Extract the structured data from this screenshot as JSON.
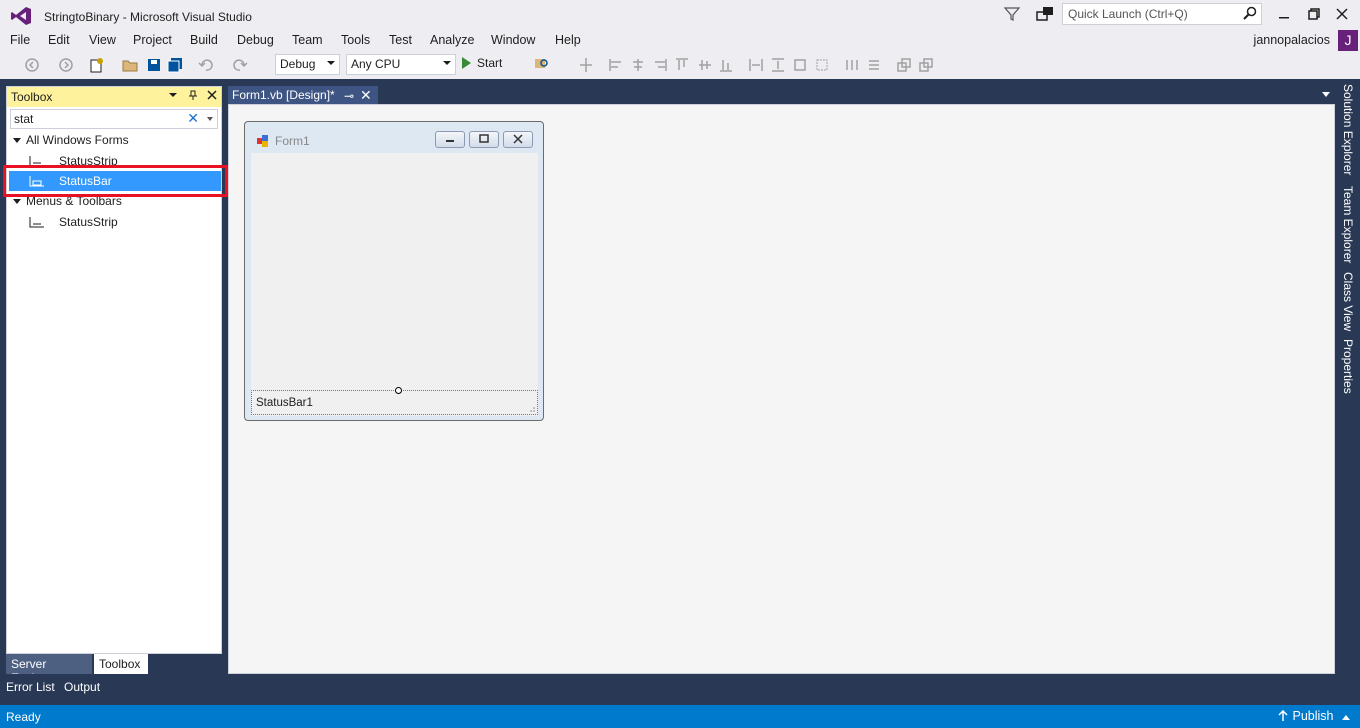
{
  "window": {
    "title": "StringtoBinary - Microsoft Visual Studio"
  },
  "quick_launch": {
    "placeholder": "Quick Launch (Ctrl+Q)"
  },
  "menu": [
    "File",
    "Edit",
    "View",
    "Project",
    "Build",
    "Debug",
    "Team",
    "Tools",
    "Test",
    "Analyze",
    "Window",
    "Help"
  ],
  "user": {
    "name": "jannopalacios",
    "initial": "J"
  },
  "toolbar": {
    "config": "Debug",
    "platform": "Any CPU",
    "start_label": "Start"
  },
  "toolbox": {
    "title": "Toolbox",
    "search_value": "stat",
    "categories": [
      {
        "label": "All Windows Forms",
        "items": [
          "StatusStrip",
          "StatusBar"
        ]
      },
      {
        "label": "Menus & Toolbars",
        "items": [
          "StatusStrip"
        ]
      }
    ],
    "selected": "StatusBar",
    "tabs": [
      "Server Explorer",
      "Toolbox"
    ]
  },
  "document_tab": {
    "label": "Form1.vb [Design]*"
  },
  "form": {
    "title": "Form1",
    "statusbar_text": "StatusBar1"
  },
  "side_tabs": [
    "Solution Explorer",
    "Team Explorer",
    "Class View",
    "Properties"
  ],
  "output_tabs": [
    "Error List",
    "Output"
  ],
  "status": {
    "text": "Ready",
    "publish": "Publish"
  },
  "colors": {
    "accent": "#007acc",
    "selection": "#3399ff",
    "highlight": "#e81123",
    "vs_purple": "#68217a"
  }
}
